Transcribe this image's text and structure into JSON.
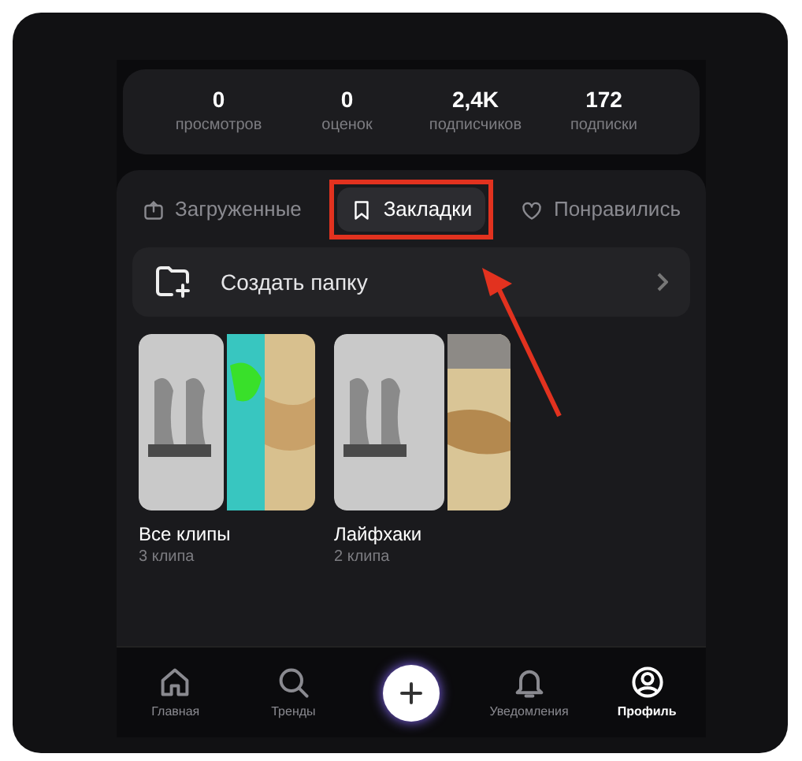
{
  "stats": [
    {
      "value": "0",
      "label": "просмотров"
    },
    {
      "value": "0",
      "label": "оценок"
    },
    {
      "value": "2,4K",
      "label": "подписчиков"
    },
    {
      "value": "172",
      "label": "подписки"
    }
  ],
  "tabs": [
    {
      "label": "Загруженные",
      "kind": "upload",
      "selected": false
    },
    {
      "label": "Закладки",
      "kind": "bookmark",
      "selected": true
    },
    {
      "label": "Понравились",
      "kind": "heart",
      "selected": false
    }
  ],
  "create_folder": {
    "label": "Создать папку"
  },
  "folders": [
    {
      "title": "Все клипы",
      "count": "3 клипа",
      "kind": "picture"
    },
    {
      "title": "Лайфхаки",
      "count": "2 клипа",
      "kind": "picture"
    }
  ],
  "nav": [
    {
      "label": "Главная",
      "kind": "home",
      "selected": false
    },
    {
      "label": "Тренды",
      "kind": "search",
      "selected": false
    },
    {
      "kind": "plus",
      "selected": false
    },
    {
      "label": "Уведомления",
      "kind": "bell",
      "selected": false
    },
    {
      "label": "Профиль",
      "kind": "profile",
      "selected": true
    }
  ]
}
